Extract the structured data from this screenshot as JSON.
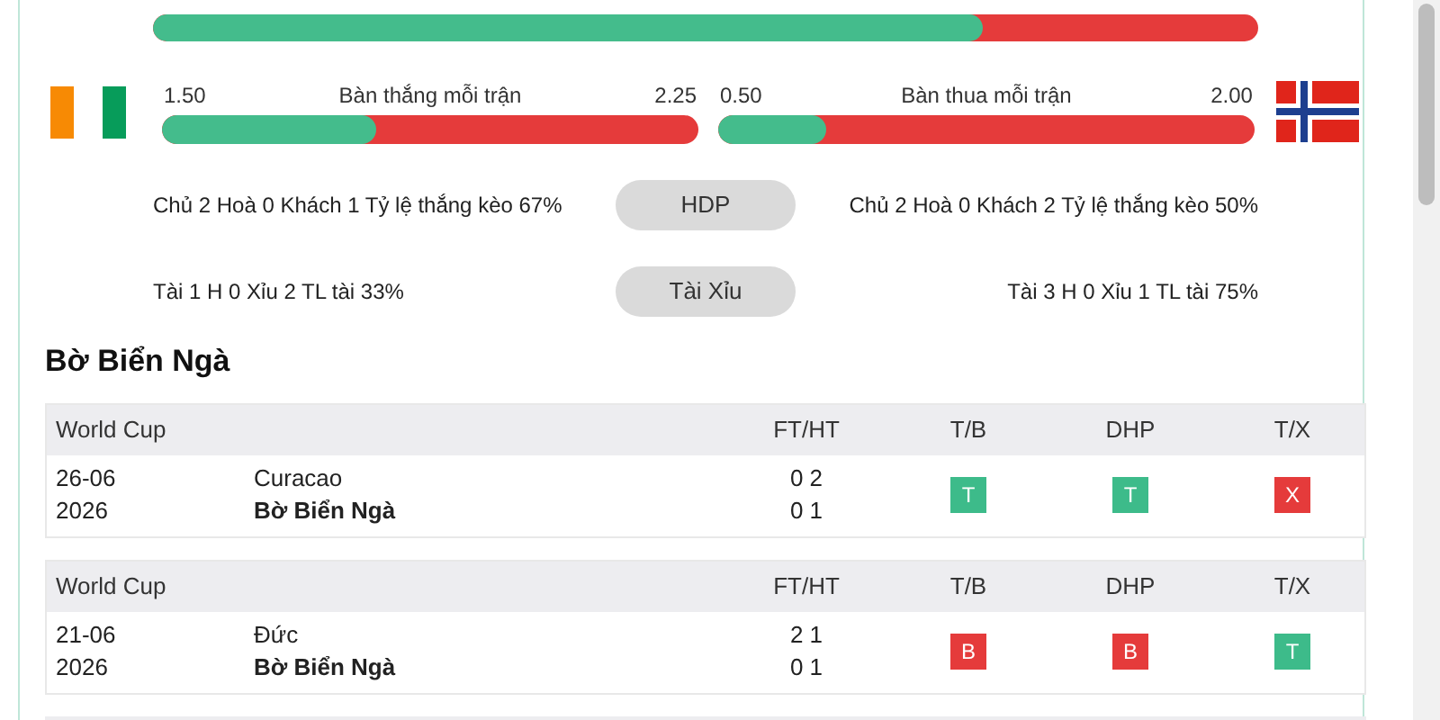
{
  "overall_bar": {
    "level": 0.75
  },
  "home_flag": {
    "kind": "tricolor"
  },
  "away_flag": {
    "kind": "cross"
  },
  "stat_bars": [
    {
      "min": "1.50",
      "label": "Bàn thắng mỗi trận",
      "max": "2.25",
      "level": 0.4
    },
    {
      "min": "0.50",
      "label": "Bàn thua mỗi trận",
      "max": "2.00",
      "level": 0.2
    }
  ],
  "comparisons": [
    {
      "home": "Chủ 2 Hoà 0 Khách 1 Tỷ lệ thắng kèo 67%",
      "button": "HDP",
      "away": "Chủ 2 Hoà 0 Khách 2 Tỷ lệ thắng kèo 50%"
    },
    {
      "home": "Tài 1 H 0 Xỉu 2 TL tài 33%",
      "button": "Tài Xỉu",
      "away": "Tài 3 H 0 Xỉu 1 TL tài 75%"
    }
  ],
  "section_title": "Bờ Biển Ngà",
  "matches": [
    {
      "league": "World Cup",
      "col_ftht": "FT/HT",
      "col_tb": "T/B",
      "col_dhp": "DHP",
      "col_tx": "T/X",
      "date": "26-06",
      "year": "2026",
      "team_1": "Curacao",
      "team_2": "Bờ Biển Ngà",
      "score_1": "0 2",
      "score_2": "0 1",
      "results": [
        {
          "text": "T",
          "color": "#3dbb8a"
        },
        {
          "text": "T",
          "color": "#3dbb8a"
        },
        {
          "text": "X",
          "color": "#e53b3b"
        }
      ]
    },
    {
      "league": "World Cup",
      "col_ftht": "FT/HT",
      "col_tb": "T/B",
      "col_dhp": "DHP",
      "col_tx": "T/X",
      "date": "21-06",
      "year": "2026",
      "team_1": "Đức",
      "team_2": "Bờ Biển Ngà",
      "score_1": "2 1",
      "score_2": "0 1",
      "results": [
        {
          "text": "B",
          "color": "#e53b3b"
        },
        {
          "text": "B",
          "color": "#e53b3b"
        },
        {
          "text": "T",
          "color": "#3dbb8a"
        }
      ]
    }
  ]
}
